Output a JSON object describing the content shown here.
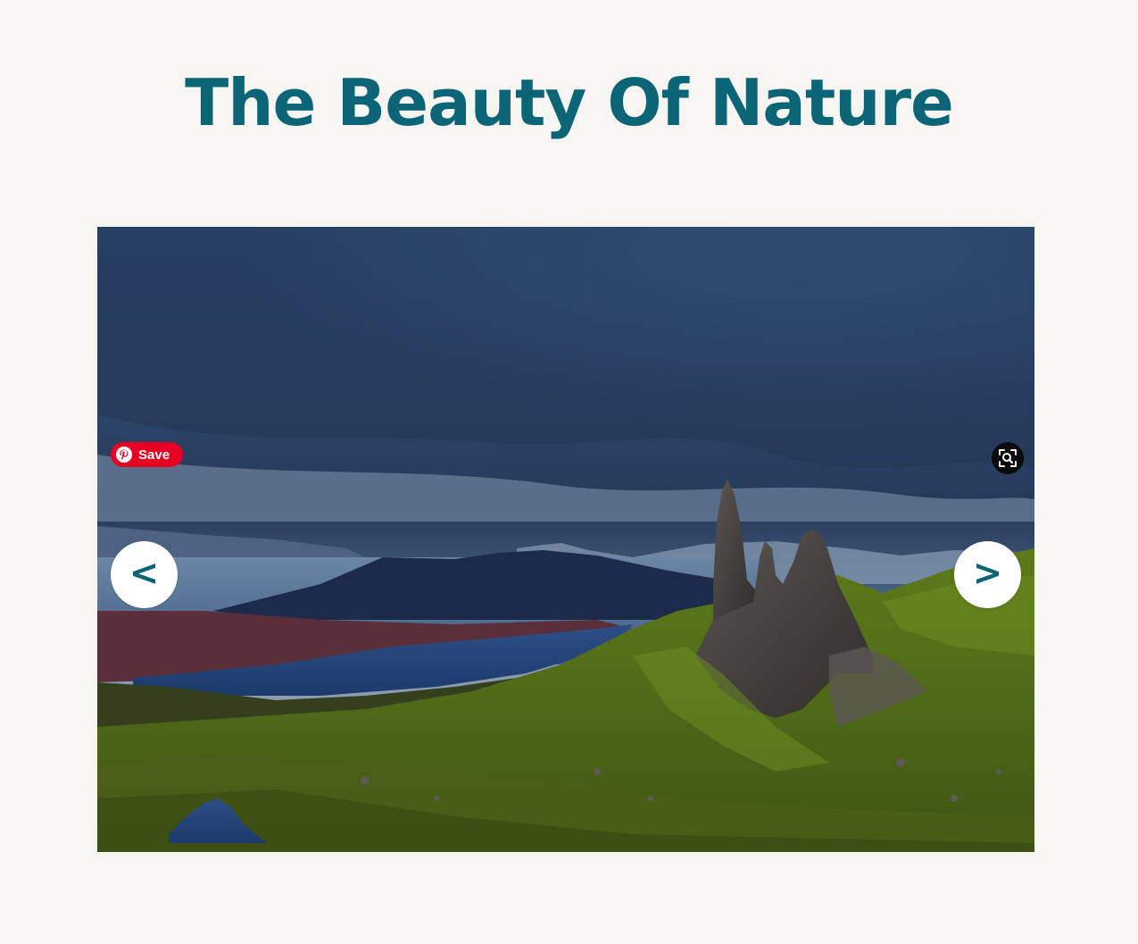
{
  "page": {
    "title": "The Beauty Of Nature"
  },
  "slider": {
    "prev_label": "<",
    "next_label": ">",
    "pin_save_label": "Save",
    "zoom_icon": "zoom-search-icon",
    "pin_icon": "pinterest-icon"
  },
  "colors": {
    "background": "#f6f5f1",
    "title": "#0c6577",
    "nav_glyph": "#0c6577",
    "pin_red": "#e60023",
    "zoom_bg": "#0b0b0b"
  }
}
